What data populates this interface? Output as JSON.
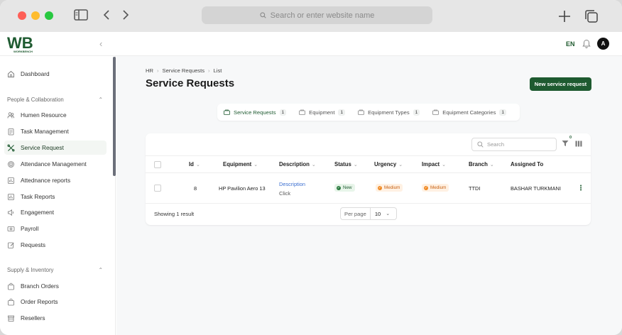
{
  "browser": {
    "url_placeholder": "Search or enter website name"
  },
  "header": {
    "logo_text": "WB",
    "logo_subtext": "WORKBENCH",
    "language": "EN",
    "avatar_initial": "A"
  },
  "sidebar": {
    "dashboard": "Dashboard",
    "section_people": "People & Collaboration",
    "people_items": [
      {
        "label": "Humen Resource",
        "icon": "people-icon"
      },
      {
        "label": "Task Management",
        "icon": "clipboard-icon"
      },
      {
        "label": "Service Request",
        "icon": "tools-icon",
        "active": true
      },
      {
        "label": "Attendance Management",
        "icon": "fingerprint-icon"
      },
      {
        "label": "Attednance reports",
        "icon": "report-icon"
      },
      {
        "label": "Task Reports",
        "icon": "report-icon"
      },
      {
        "label": "Engagement",
        "icon": "megaphone-icon"
      },
      {
        "label": "Payroll",
        "icon": "money-icon"
      },
      {
        "label": "Requests",
        "icon": "edit-icon"
      }
    ],
    "section_supply": "Supply & Inventory",
    "supply_items": [
      {
        "label": "Branch Orders",
        "icon": "bag-icon"
      },
      {
        "label": "Order Reports",
        "icon": "bag-icon"
      },
      {
        "label": "Resellers",
        "icon": "store-icon"
      }
    ]
  },
  "breadcrumb": [
    "HR",
    "Service Requests",
    "List"
  ],
  "page_title": "Service Requests",
  "new_button": "New service request",
  "tabs": [
    {
      "label": "Service Requests",
      "count": "1",
      "active": true
    },
    {
      "label": "Equipment",
      "count": "1"
    },
    {
      "label": "Equipment Types",
      "count": "1"
    },
    {
      "label": "Equipment Categories",
      "count": "1"
    }
  ],
  "table": {
    "search_placeholder": "Search",
    "filter_count": "0",
    "columns": [
      "Id",
      "Equipment",
      "Description",
      "Status",
      "Urgency",
      "Impact",
      "Branch",
      "Assigned To"
    ],
    "rows": [
      {
        "id": "8",
        "equipment": "HP Pavilion Aero 13",
        "description": "Description",
        "description_action": "Click",
        "status": "New",
        "urgency": "Medium",
        "impact": "Medium",
        "branch": "TTDI",
        "assigned_to": "BASHAR TURKMANI"
      }
    ],
    "showing": "Showing 1 result",
    "per_page_label": "Per page",
    "per_page_value": "10"
  },
  "colors": {
    "brand_green": "#1e5a30",
    "medium_orange": "#f08a24"
  }
}
